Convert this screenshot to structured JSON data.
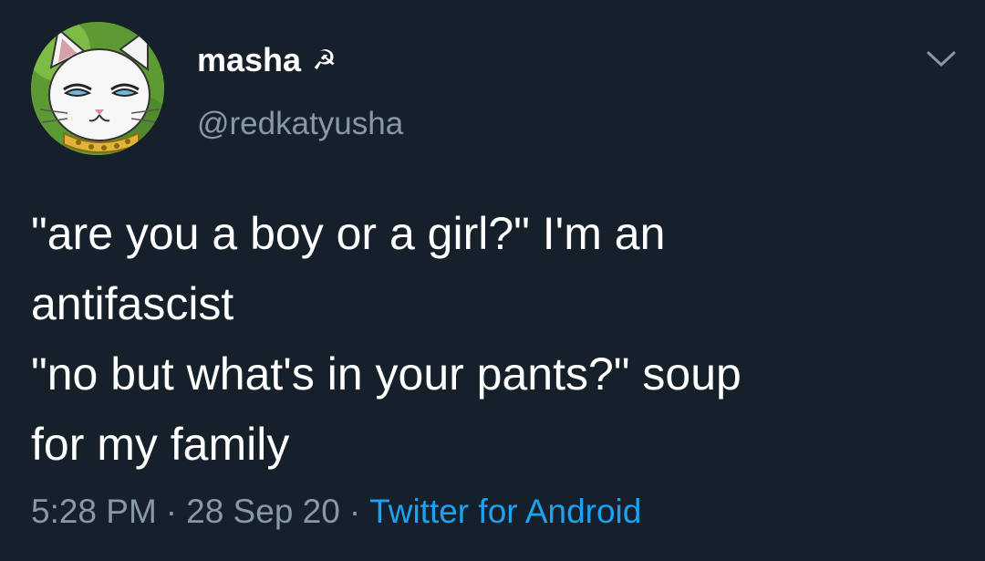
{
  "user": {
    "display_name": "masha",
    "name_badge": "☭",
    "handle": "@redkatyusha"
  },
  "tweet": {
    "lines": [
      "\"are you a boy or a girl?\" I'm an",
      "antifascist",
      "\"no but what's in your pants?\" soup",
      "for my family"
    ]
  },
  "meta": {
    "time": "5:28 PM",
    "separator": "·",
    "date": "28 Sep 20",
    "source": "Twitter for Android"
  },
  "icons": {
    "caret": "chevron-down-icon",
    "avatar": "cat-avatar"
  },
  "colors": {
    "background": "#15202b",
    "text": "#ffffff",
    "secondary": "#8899a6",
    "link": "#1da1f2"
  }
}
